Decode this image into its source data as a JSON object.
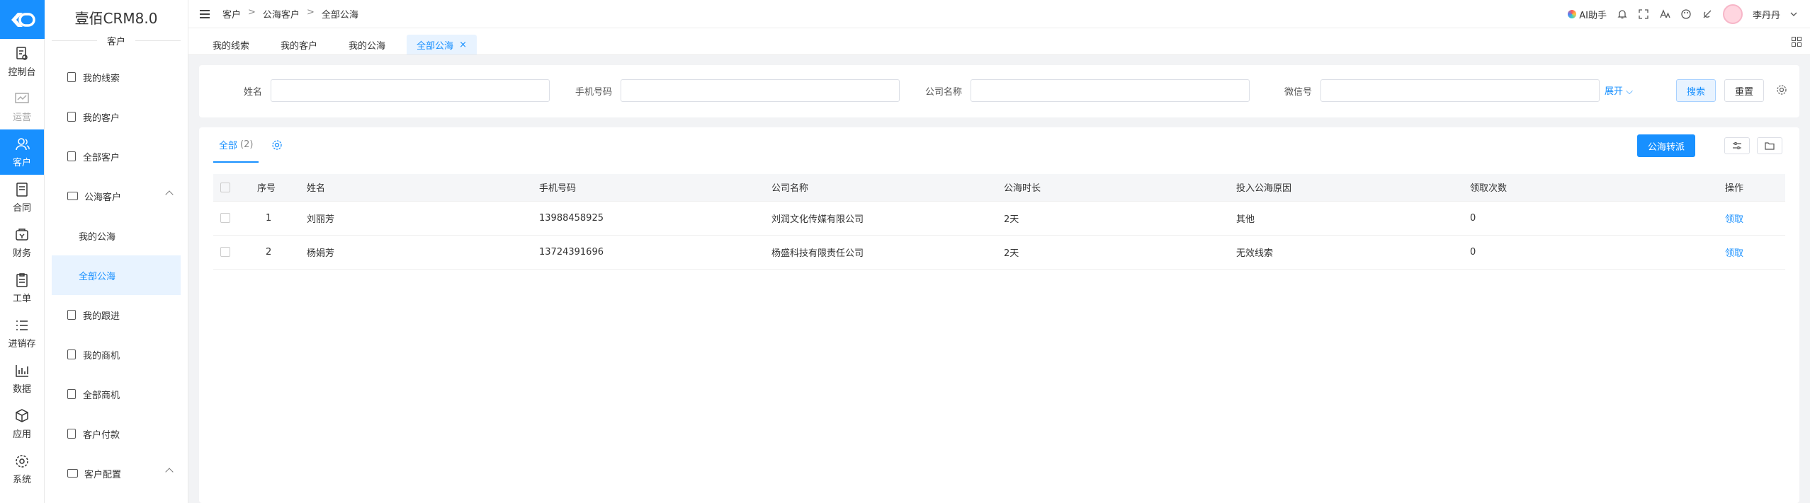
{
  "app": {
    "title": "壹佰CRM8.0",
    "section_title": "客户"
  },
  "rail": [
    {
      "label": "控制台",
      "icon": "dashboard-icon",
      "state": "normal"
    },
    {
      "label": "运营",
      "icon": "operations-icon",
      "state": "muted"
    },
    {
      "label": "客户",
      "icon": "customer-icon",
      "state": "active"
    },
    {
      "label": "合同",
      "icon": "contract-icon",
      "state": "normal"
    },
    {
      "label": "财务",
      "icon": "finance-icon",
      "state": "normal"
    },
    {
      "label": "工单",
      "icon": "ticket-icon",
      "state": "normal"
    },
    {
      "label": "进销存",
      "icon": "inventory-icon",
      "state": "normal"
    },
    {
      "label": "数据",
      "icon": "data-icon",
      "state": "normal"
    },
    {
      "label": "应用",
      "icon": "apps-icon",
      "state": "normal"
    },
    {
      "label": "系统",
      "icon": "system-icon",
      "state": "normal"
    }
  ],
  "submenu": [
    {
      "label": "我的线索"
    },
    {
      "label": "我的客户"
    },
    {
      "label": "全部客户"
    },
    {
      "label": "公海客户"
    },
    {
      "label": "我的公海"
    },
    {
      "label": "全部公海"
    },
    {
      "label": "我的跟进"
    },
    {
      "label": "我的商机"
    },
    {
      "label": "全部商机"
    },
    {
      "label": "客户付款"
    },
    {
      "label": "客户配置"
    }
  ],
  "breadcrumb": [
    "客户",
    "公海客户",
    "全部公海"
  ],
  "breadcrumb_sep": ">",
  "topbar": {
    "ai_label": "AI助手",
    "user_name": "李丹丹"
  },
  "tabs": [
    {
      "label": "我的线索"
    },
    {
      "label": "我的客户"
    },
    {
      "label": "我的公海"
    },
    {
      "label": "全部公海",
      "close": "×"
    }
  ],
  "search": {
    "fields": [
      {
        "label": "姓名",
        "value": ""
      },
      {
        "label": "手机号码",
        "value": ""
      },
      {
        "label": "公司名称",
        "value": ""
      },
      {
        "label": "微信号",
        "value": ""
      }
    ],
    "expand_label": "展开",
    "search_label": "搜索",
    "reset_label": "重置"
  },
  "list": {
    "tab_label": "全部",
    "tab_count": "(2)",
    "transfer_label": "公海转派",
    "columns": [
      "序号",
      "姓名",
      "手机号码",
      "公司名称",
      "公海时长",
      "投入公海原因",
      "领取次数",
      "操作"
    ],
    "rows": [
      {
        "no": "1",
        "name": "刘丽芳",
        "phone": "13988458925",
        "company": "刘润文化传媒有限公司",
        "duration": "2天",
        "reason": "其他",
        "times": "0",
        "action": "领取"
      },
      {
        "no": "2",
        "name": "杨娟芳",
        "phone": "13724391696",
        "company": "杨盛科技有限责任公司",
        "duration": "2天",
        "reason": "无效线索",
        "times": "0",
        "action": "领取"
      }
    ]
  },
  "colors": {
    "primary": "#1890ff",
    "active_bg": "#e8f3ff"
  }
}
